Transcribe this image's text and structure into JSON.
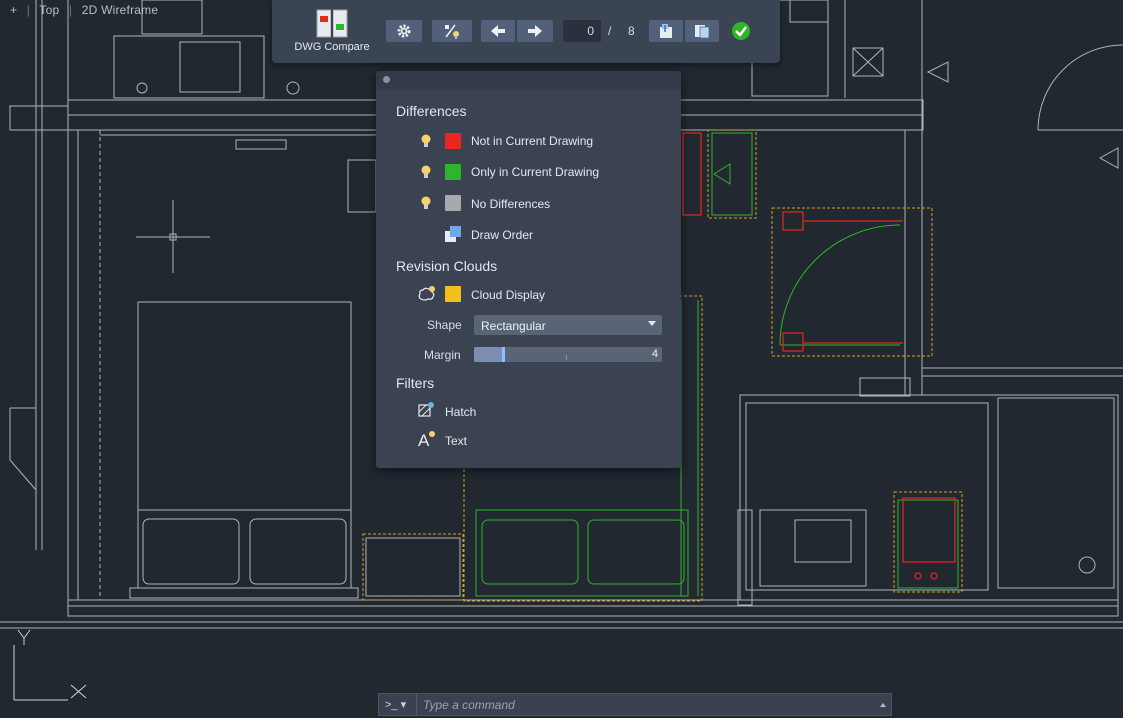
{
  "viewport": {
    "plus": "+",
    "view": "Top",
    "style": "2D Wireframe"
  },
  "toolbar": {
    "title": "DWG Compare",
    "current_index": "0",
    "separator": "/",
    "total": "8"
  },
  "panel": {
    "differences_heading": "Differences",
    "not_in_current": "Not in Current Drawing",
    "only_in_current": "Only in Current Drawing",
    "no_differences": "No Differences",
    "draw_order": "Draw Order",
    "revision_clouds_heading": "Revision Clouds",
    "cloud_display": "Cloud Display",
    "shape_label": "Shape",
    "shape_value": "Rectangular",
    "margin_label": "Margin",
    "margin_value": "4",
    "filters_heading": "Filters",
    "hatch": "Hatch",
    "text": "Text"
  },
  "colors": {
    "not_in_current": "#e8271f",
    "only_in_current": "#2fb52a",
    "no_differences": "#a6a9ad",
    "cloud": "#f2c018",
    "bulb": "#f3d36b"
  },
  "ucs": {
    "y": "Y",
    "x": "X"
  },
  "commandline": {
    "prompt": ">_",
    "placeholder": "Type a command"
  }
}
